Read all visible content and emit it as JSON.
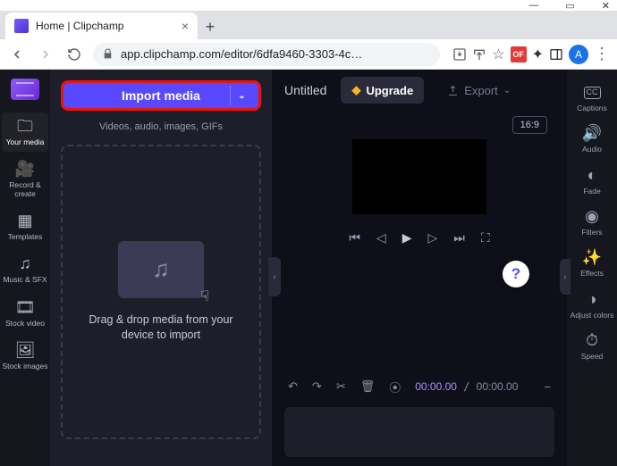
{
  "browser": {
    "tab_title": "Home | Clipchamp",
    "url": "app.clipchamp.com/editor/6dfa9460-3303-4c…",
    "avatar_letter": "A",
    "ext_label": "OF"
  },
  "left_rail": [
    {
      "label": "Your media",
      "name": "your-media"
    },
    {
      "label": "Record & create",
      "name": "record-create"
    },
    {
      "label": "Templates",
      "name": "templates"
    },
    {
      "label": "Music & SFX",
      "name": "music-sfx"
    },
    {
      "label": "Stock video",
      "name": "stock-video"
    },
    {
      "label": "Stock images",
      "name": "stock-images"
    }
  ],
  "media_panel": {
    "import_label": "Import media",
    "hint": "Videos, audio, images, GIFs",
    "drop_text": "Drag & drop media from your device to import"
  },
  "header": {
    "project_title": "Untitled",
    "upgrade_label": "Upgrade",
    "export_label": "Export"
  },
  "preview": {
    "aspect": "16:9",
    "time_current": "00:00.00",
    "time_total": "00:00.00"
  },
  "right_rail": [
    {
      "label": "Captions",
      "name": "captions"
    },
    {
      "label": "Audio",
      "name": "audio"
    },
    {
      "label": "Fade",
      "name": "fade"
    },
    {
      "label": "Filters",
      "name": "filters"
    },
    {
      "label": "Effects",
      "name": "effects"
    },
    {
      "label": "Adjust colors",
      "name": "adjust-colors"
    },
    {
      "label": "Speed",
      "name": "speed"
    }
  ],
  "help_label": "?"
}
